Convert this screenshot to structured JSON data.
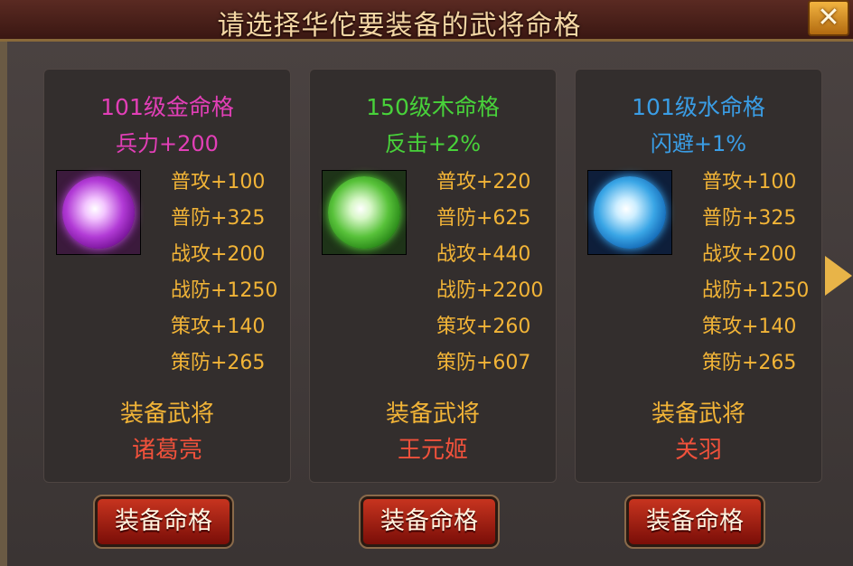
{
  "dialog": {
    "title": "请选择华佗要装备的武将命格",
    "close_icon": "close-icon"
  },
  "colors": {
    "gold": "#f2b437",
    "red": "#f0513b",
    "magenta": "#e23fb7",
    "green": "#48d23a",
    "blue": "#3a9de5"
  },
  "cards": [
    {
      "name": "101级金命格",
      "main_stat": "兵力+200",
      "color": "#e23fb7",
      "orb": "purple-orb-icon",
      "stats": [
        "普攻+100",
        "普防+325",
        "战攻+200",
        "战防+1250",
        "策攻+140",
        "策防+265"
      ],
      "equip_label": "装备武将",
      "hero": "诸葛亮",
      "button": "装备命格"
    },
    {
      "name": "150级木命格",
      "main_stat": "反击+2%",
      "color": "#48d23a",
      "orb": "green-orb-icon",
      "stats": [
        "普攻+220",
        "普防+625",
        "战攻+440",
        "战防+2200",
        "策攻+260",
        "策防+607"
      ],
      "equip_label": "装备武将",
      "hero": "王元姬",
      "button": "装备命格"
    },
    {
      "name": "101级水命格",
      "main_stat": "闪避+1%",
      "color": "#3a9de5",
      "orb": "blue-orb-icon",
      "stats": [
        "普攻+100",
        "普防+325",
        "战攻+200",
        "战防+1250",
        "策攻+140",
        "策防+265"
      ],
      "equip_label": "装备武将",
      "hero": "关羽",
      "button": "装备命格"
    }
  ]
}
